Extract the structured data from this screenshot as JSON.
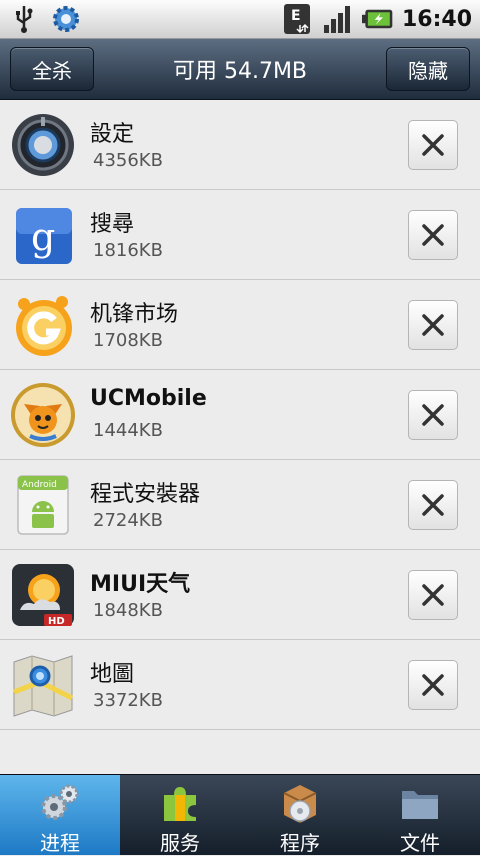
{
  "status_bar": {
    "time": "16:40",
    "icons": [
      "usb-icon",
      "settings-gear-icon",
      "edge-data-icon",
      "signal-icon",
      "battery-charging-icon"
    ]
  },
  "header": {
    "kill_all_label": "全杀",
    "title": "可用 54.7MB",
    "hide_label": "隐藏"
  },
  "apps": [
    {
      "name": "設定",
      "size": "4356KB",
      "icon": "settings-icon"
    },
    {
      "name": "搜尋",
      "size": "1816KB",
      "icon": "google-search-icon"
    },
    {
      "name": "机锋市场",
      "size": "1708KB",
      "icon": "gfan-market-icon"
    },
    {
      "name": "UCMobile",
      "size": "1444KB",
      "icon": "ucmobile-icon"
    },
    {
      "name": "程式安裝器",
      "size": "2724KB",
      "icon": "android-installer-icon"
    },
    {
      "name": "MIUI天气",
      "size": "1848KB",
      "icon": "miui-weather-icon"
    },
    {
      "name": "地圖",
      "size": "3372KB",
      "icon": "maps-icon"
    }
  ],
  "tabs": [
    {
      "label": "进程",
      "icon": "gears-icon",
      "active": true
    },
    {
      "label": "服务",
      "icon": "puzzle-icon",
      "active": false
    },
    {
      "label": "程序",
      "icon": "package-disc-icon",
      "active": false
    },
    {
      "label": "文件",
      "icon": "folder-icon",
      "active": false
    }
  ],
  "colors": {
    "header": "#2a3748",
    "active_tab": "#2b8ad6",
    "list_bg": "#ececec"
  }
}
